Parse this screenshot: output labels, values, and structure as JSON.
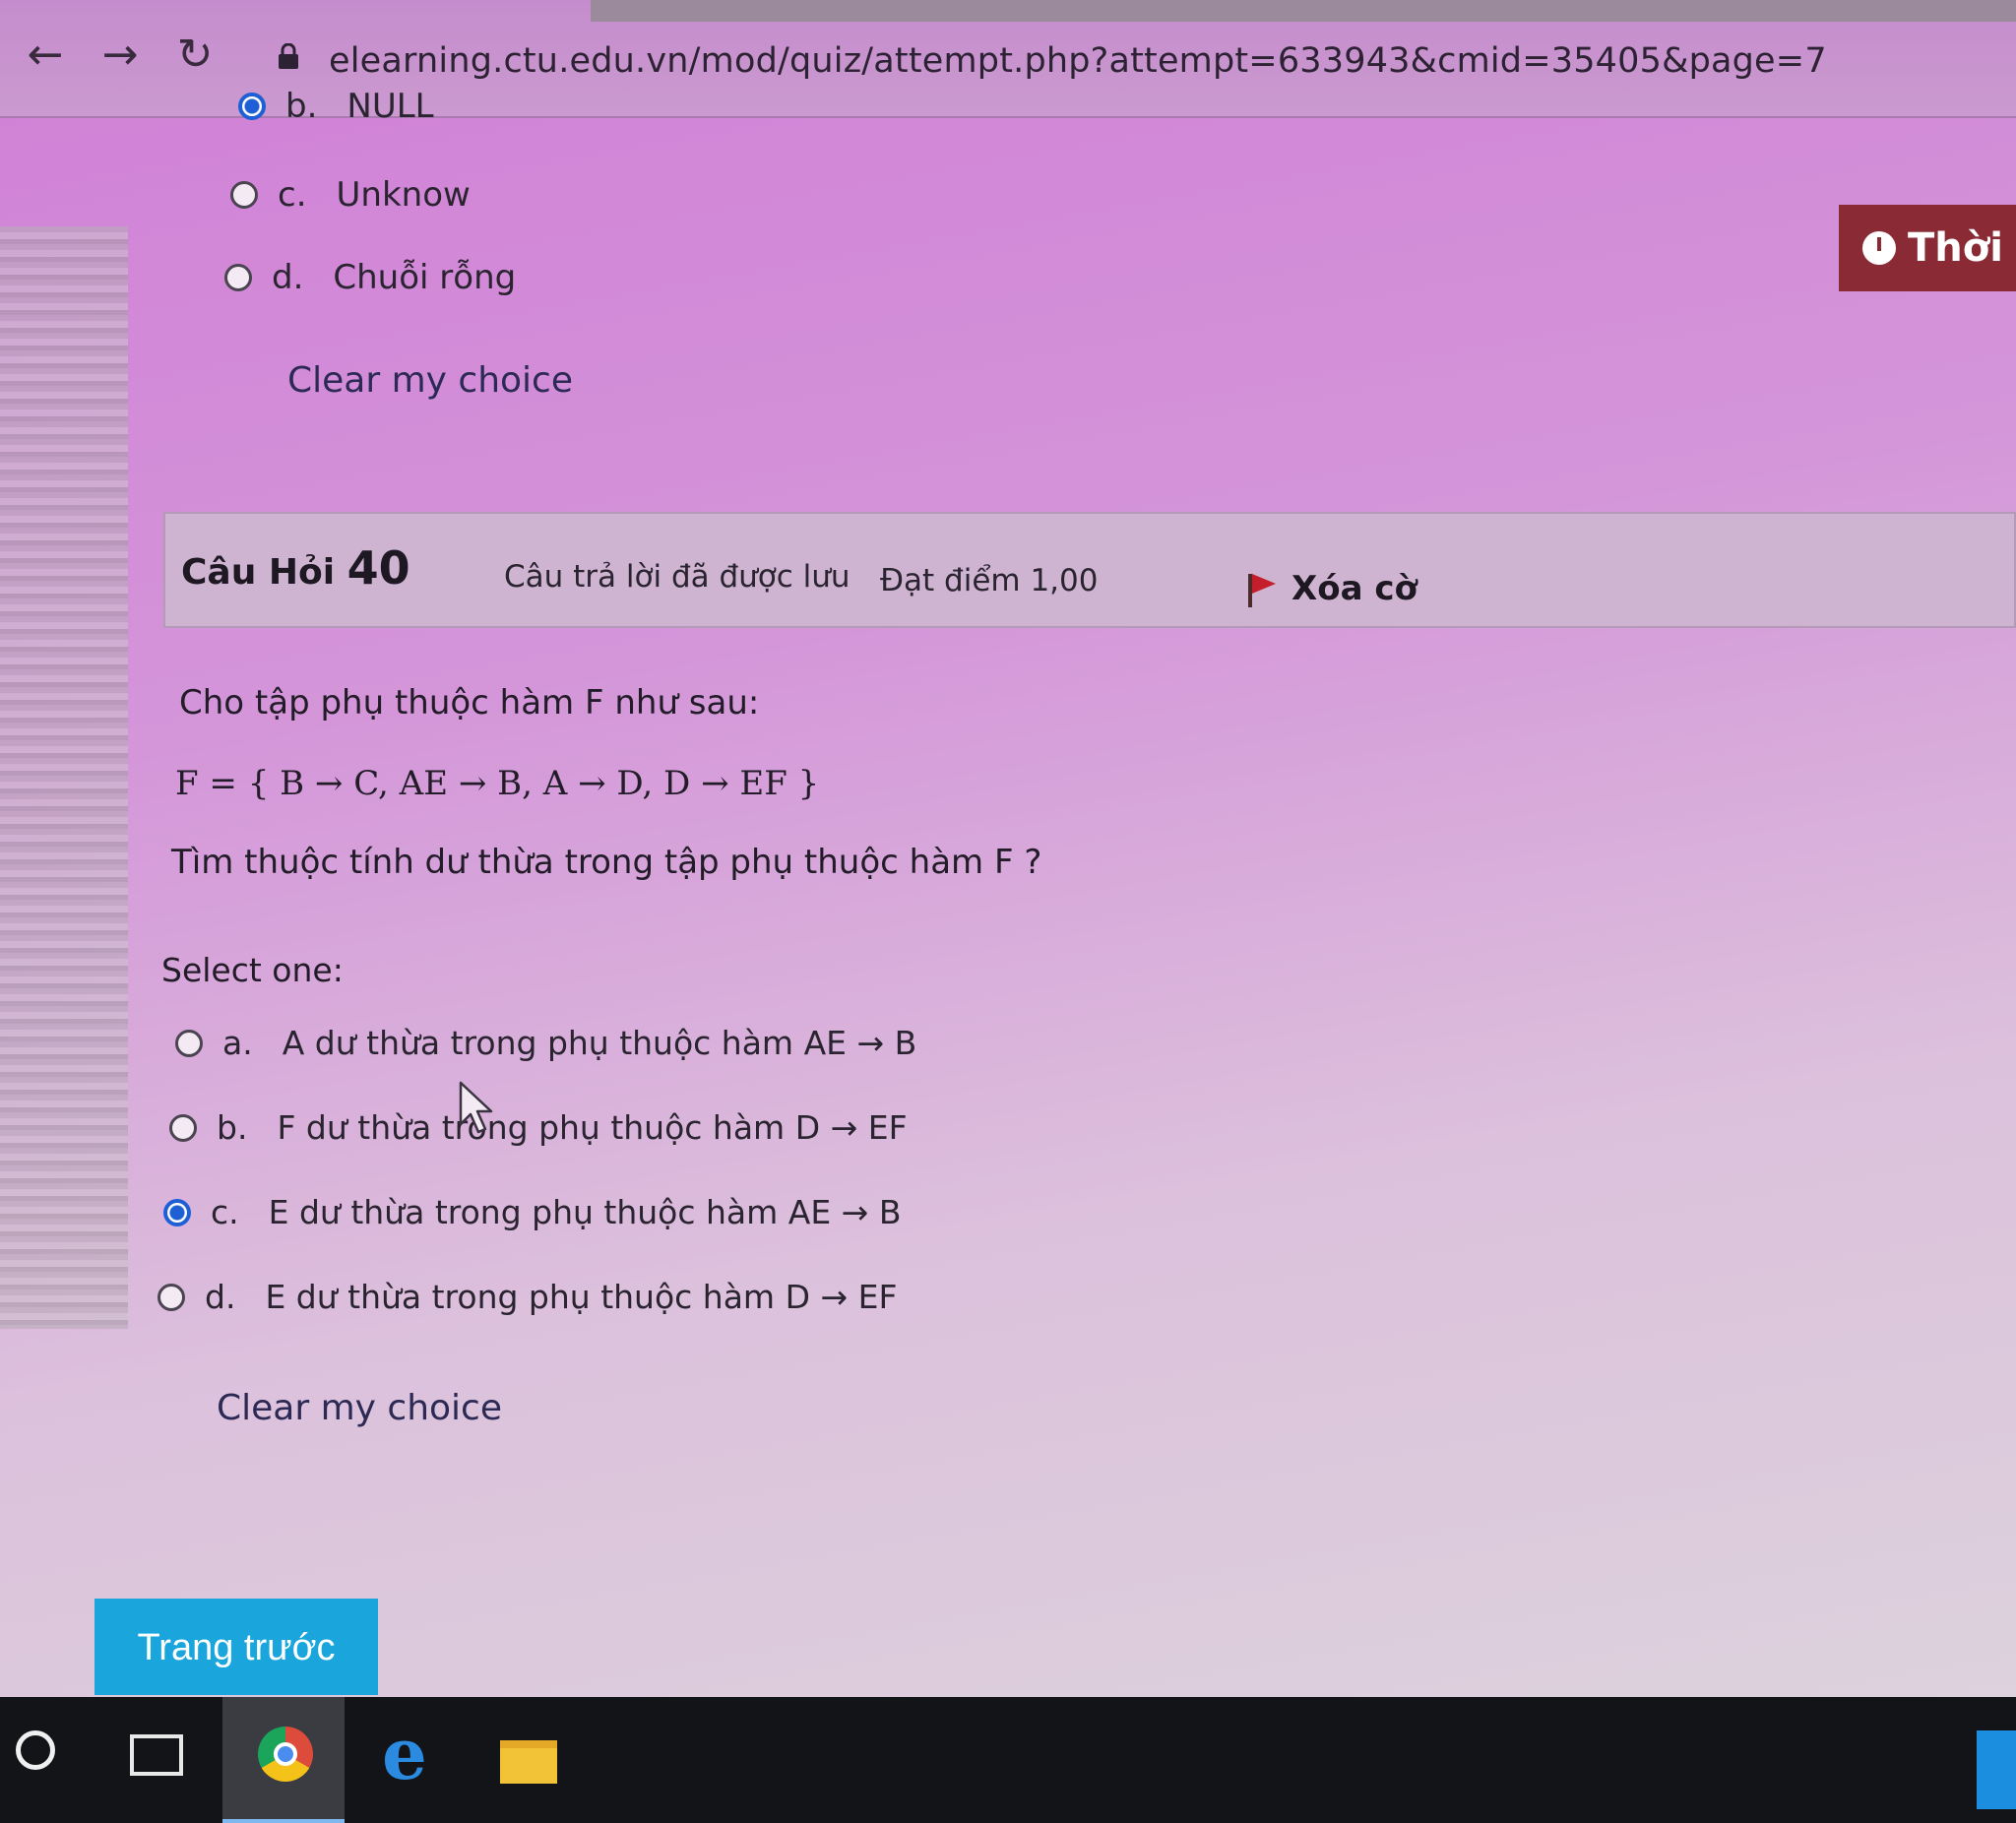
{
  "browser": {
    "url": "elearning.ctu.edu.vn/mod/quiz/attempt.php?attempt=633943&cmid=35405&page=7",
    "back_icon": "arrow-left-icon",
    "forward_icon": "arrow-right-icon",
    "reload_icon": "reload-icon",
    "lock_icon": "lock-icon"
  },
  "timer": {
    "label": "Thời g",
    "icon": "clock-icon"
  },
  "prev_question": {
    "options": [
      {
        "letter": "b.",
        "text": "NULL",
        "checked": true
      },
      {
        "letter": "c.",
        "text": "Unknow",
        "checked": false
      },
      {
        "letter": "d.",
        "text": "Chuỗi rỗng",
        "checked": false
      }
    ],
    "clear_label": "Clear my choice"
  },
  "question": {
    "title_prefix": "Câu Hỏi",
    "number": "40",
    "status": "Câu trả lời đã được lưu",
    "mark": "Đạt điểm 1,00",
    "flag_label": "Xóa cờ",
    "flag_icon": "flag-icon",
    "text_line1": "Cho tập phụ thuộc hàm F như sau:",
    "formula": "F = { B → C, AE → B, A → D, D → EF }",
    "text_line2": "Tìm thuộc tính dư thừa trong tập phụ thuộc hàm F ?",
    "select_label": "Select one:",
    "options": [
      {
        "letter": "a.",
        "text": "A dư thừa trong phụ thuộc hàm AE → B",
        "checked": false
      },
      {
        "letter": "b.",
        "text": "F dư thừa trong phụ thuộc hàm D → EF",
        "checked": false
      },
      {
        "letter": "c.",
        "text": "E dư thừa trong phụ thuộc hàm AE → B",
        "checked": true
      },
      {
        "letter": "d.",
        "text": "E dư thừa trong phụ thuộc hàm D → EF",
        "checked": false
      }
    ],
    "clear_label": "Clear my choice"
  },
  "nav": {
    "prev_page_label": "Trang trước"
  },
  "taskbar": {
    "items": [
      "search-icon",
      "task-view-icon",
      "chrome-icon",
      "edge-icon",
      "file-explorer-icon"
    ]
  },
  "colors": {
    "accent_button": "#1aa6dc",
    "timer_bg": "#8a2a35",
    "radio_checked": "#1f5fd6",
    "flag": "#c41e2a"
  }
}
